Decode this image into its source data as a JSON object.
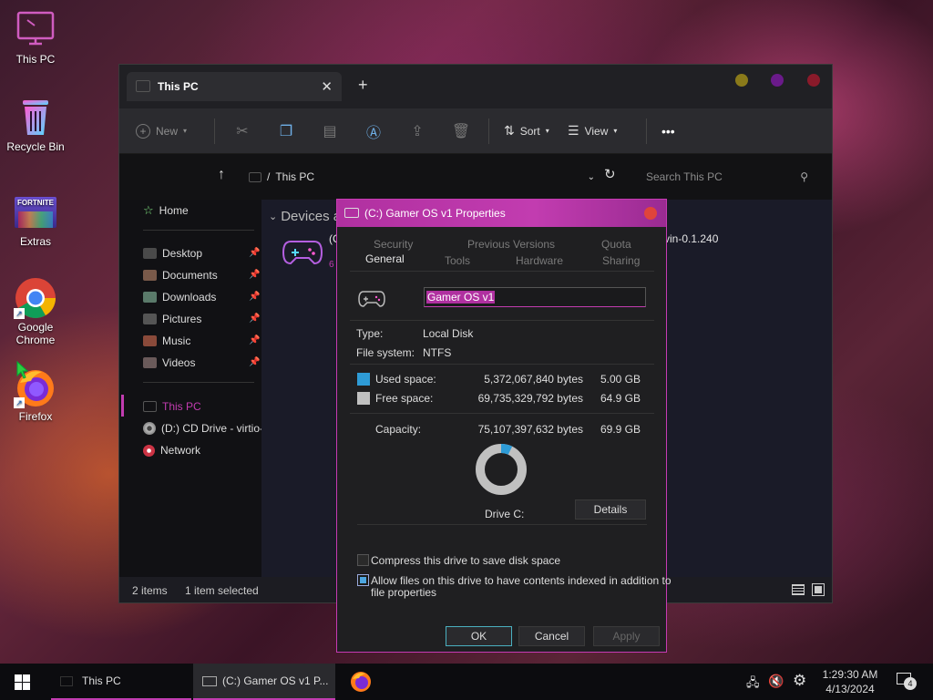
{
  "desktop": {
    "icons": [
      {
        "label": "This PC",
        "icon": "monitor-icon"
      },
      {
        "label": "Recycle Bin",
        "icon": "recycle-bin-icon"
      },
      {
        "label": "Extras",
        "icon": "fortnite-folder-icon",
        "image_text": "FORTNITE"
      },
      {
        "label": "Google Chrome",
        "icon": "chrome-icon"
      },
      {
        "label": "Firefox",
        "icon": "firefox-icon"
      }
    ]
  },
  "explorer": {
    "tab_title": "This PC",
    "toolbar": {
      "new_label": "New",
      "sort_label": "Sort",
      "view_label": "View",
      "more_label": "•••"
    },
    "address": {
      "separator": "/",
      "path": "This PC",
      "search_placeholder": "Search This PC"
    },
    "sidebar": {
      "home": "Home",
      "quick": [
        "Desktop",
        "Documents",
        "Downloads",
        "Pictures",
        "Music",
        "Videos"
      ],
      "this_pc": "This PC",
      "cd_drive": "(D:) CD Drive - virtio-",
      "network": "Network"
    },
    "content": {
      "section": "Devices a",
      "drive_partial_left": "(C",
      "drive_partial_right": "vin-0.1.240",
      "drive_partial_bottom": "6"
    },
    "status": {
      "items": "2 items",
      "selected": "1 item selected"
    }
  },
  "properties": {
    "title": "(C:) Gamer OS v1 Properties",
    "tabs_row1": [
      "Security",
      "Previous Versions",
      "Quota"
    ],
    "tabs_row2": [
      "General",
      "Tools",
      "Hardware",
      "Sharing"
    ],
    "active_tab": "General",
    "name_value": "Gamer OS v1",
    "type_label": "Type:",
    "type_value": "Local Disk",
    "fs_label": "File system:",
    "fs_value": "NTFS",
    "used_label": "Used space:",
    "used_bytes": "5,372,067,840 bytes",
    "used_gb": "5.00 GB",
    "free_label": "Free space:",
    "free_bytes": "69,735,329,792 bytes",
    "free_gb": "64.9 GB",
    "capacity_label": "Capacity:",
    "capacity_bytes": "75,107,397,632 bytes",
    "capacity_gb": "69.9 GB",
    "used_fraction": 0.0715,
    "drive_label": "Drive C:",
    "details_label": "Details",
    "compress_label": "Compress this drive to save disk space",
    "index_label_line1": "Allow files on this drive to have contents indexed in addition to",
    "index_label_line2": "file properties",
    "compress_checked": false,
    "index_checked": true,
    "ok_label": "OK",
    "cancel_label": "Cancel",
    "apply_label": "Apply",
    "colors": {
      "used": "#2e9bd6",
      "free": "#c0c0c0",
      "title": "#c23cb0"
    }
  },
  "taskbar": {
    "item1": "This PC",
    "item2": "(C:) Gamer OS v1 P...",
    "time": "1:29:30 AM",
    "date": "4/13/2024",
    "notification_count": "4"
  }
}
